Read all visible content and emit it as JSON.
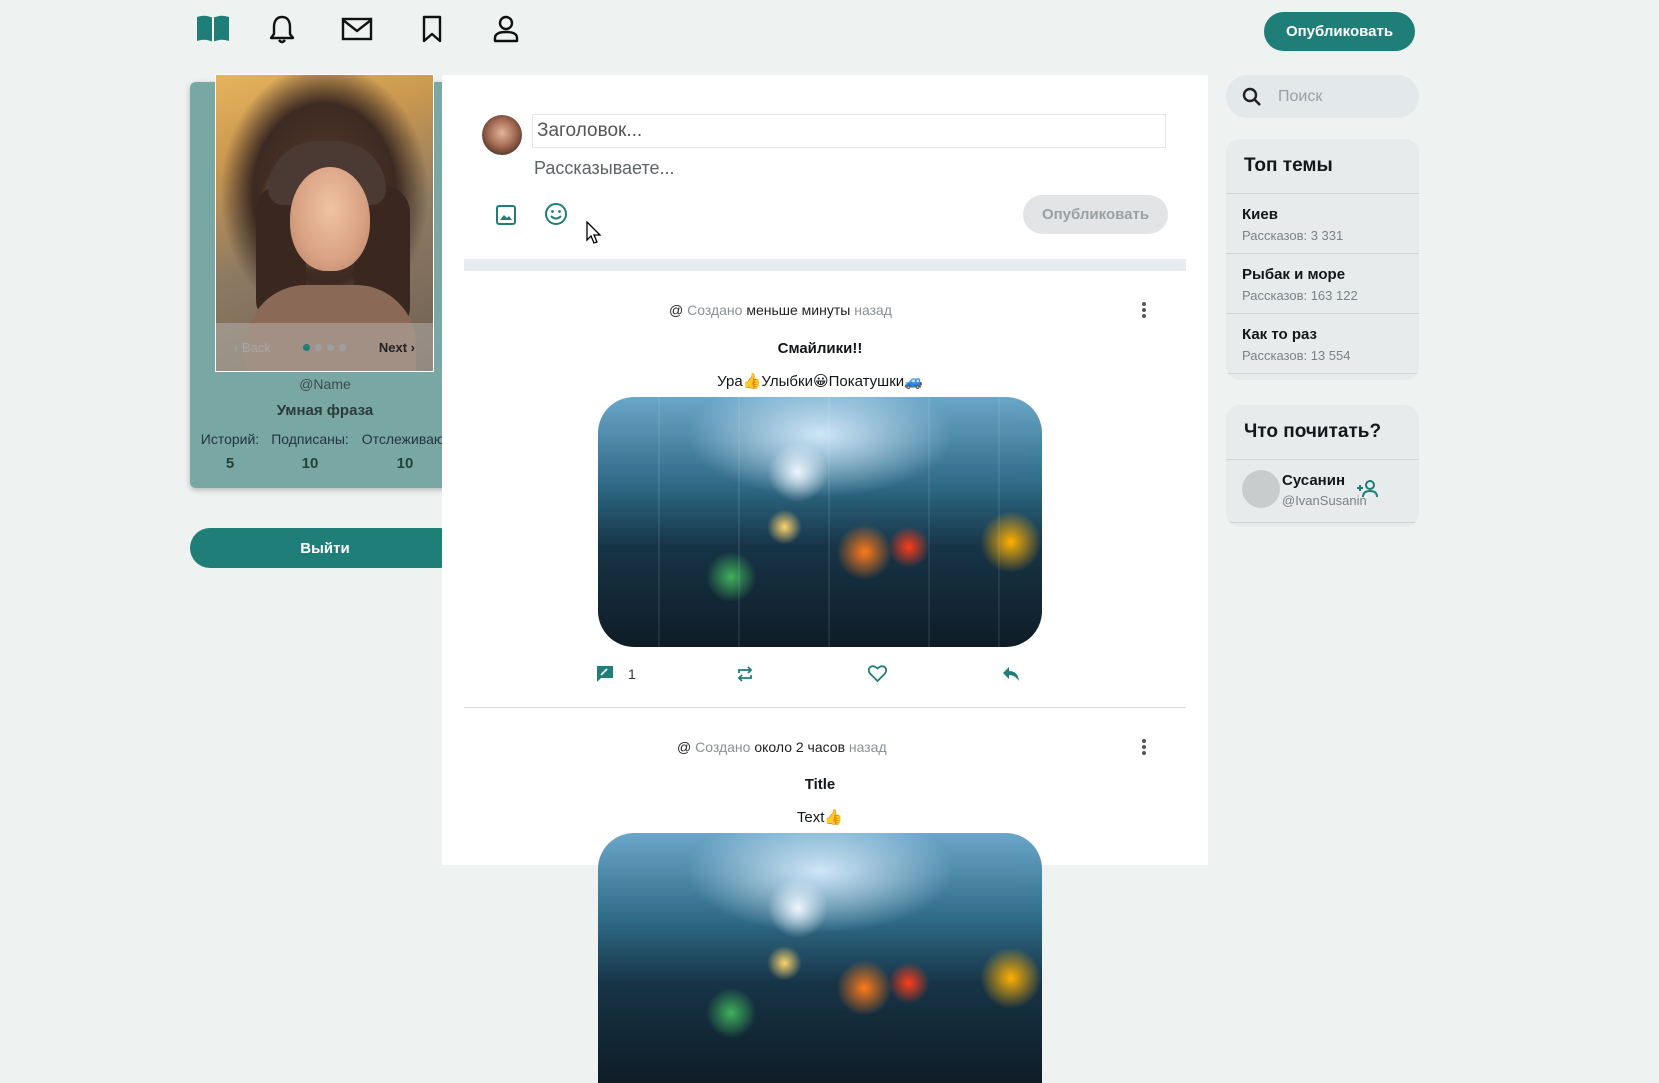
{
  "nav": {
    "publish_label": "Опубликовать"
  },
  "profile": {
    "carousel_back": "Back",
    "carousel_next": "Next",
    "handle": "@Name",
    "phrase": "Умная фраза",
    "stats": [
      {
        "label": "Историй:",
        "value": "5"
      },
      {
        "label": "Подписаны:",
        "value": "10"
      },
      {
        "label": "Отслеживаю:",
        "value": "10"
      }
    ],
    "logout_label": "Выйти"
  },
  "composer": {
    "title_placeholder": "Заголовок...",
    "text_placeholder": "Рассказываете...",
    "publish_label": "Опубликовать"
  },
  "posts": [
    {
      "at": "@",
      "created": "Создано",
      "time": "меньше минуты",
      "ago": "назад",
      "title": "Смайлики!!",
      "text": "Ура👍Улыбки😀Покатушки🚙",
      "comment_count": "1"
    },
    {
      "at": "@",
      "created": "Создано",
      "time": "около 2 часов",
      "ago": "назад",
      "title": "Title",
      "text": "Text👍"
    }
  ],
  "search": {
    "placeholder": "Поиск"
  },
  "top_topics": {
    "title": "Топ темы",
    "items": [
      {
        "name": "Киев",
        "count": "Рассказов: 3 331"
      },
      {
        "name": "Рыбак и море",
        "count": "Рассказов: 163 122"
      },
      {
        "name": "Как то раз",
        "count": "Рассказов: 13 554"
      }
    ]
  },
  "who_to_read": {
    "title": "Что почитать?",
    "users": [
      {
        "name": "Сусанин",
        "handle": "@IvanSusanin"
      }
    ]
  },
  "colors": {
    "accent": "#1f7f78",
    "profile_card": "#79a8a4",
    "background": "#eef2f1"
  }
}
